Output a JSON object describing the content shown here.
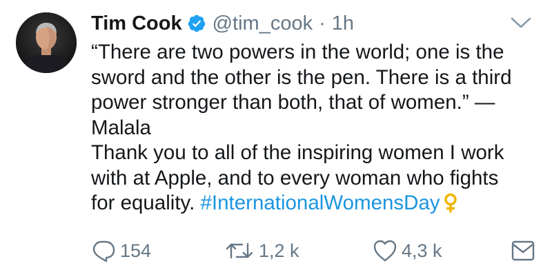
{
  "tweet": {
    "author": {
      "name": "Tim Cook",
      "handle": "@tim_cook",
      "verified": true
    },
    "separator": "·",
    "time": "1h",
    "text": {
      "quote_line1": "“There are two powers in the world; one is the",
      "quote_line2": "sword and the other is the pen. There is a third",
      "quote_line3": "power stronger than both, that of women.” —",
      "quote_line4": "Malala",
      "thanks_line1": "Thank you to all of the inspiring women I work",
      "thanks_line2": "with at Apple, and to every woman who fights",
      "thanks_line3": "for equality.",
      "hashtag": "#InternationalWomensDay"
    },
    "actions": {
      "replies": "154",
      "retweets": "1,2 k",
      "likes": "4,3 k"
    },
    "colors": {
      "link": "#1b95e0",
      "muted": "#657786",
      "verified_badge": "#1da1f2",
      "venus_symbol": "#f2b705"
    },
    "icons": [
      "verified-badge-icon",
      "chevron-down-icon",
      "venus-symbol-icon",
      "reply-icon",
      "retweet-icon",
      "like-icon",
      "direct-message-icon"
    ]
  }
}
